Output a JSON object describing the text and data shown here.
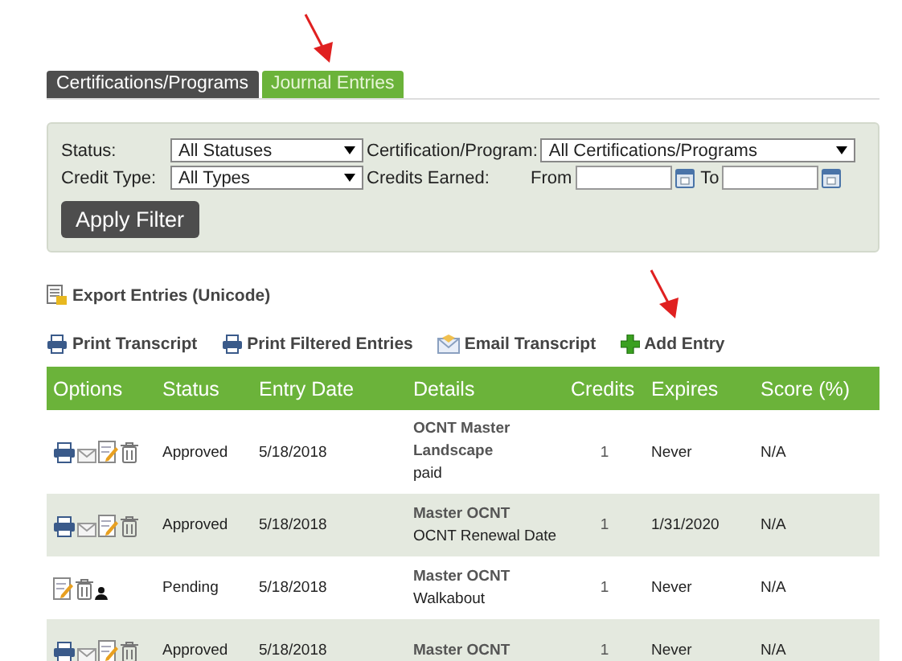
{
  "tabs": [
    {
      "label": "Certifications/Programs",
      "selected": false
    },
    {
      "label": "Journal Entries",
      "selected": true
    }
  ],
  "filter": {
    "status": {
      "label": "Status:",
      "value": "All Statuses"
    },
    "certification": {
      "label": "Certification/Program:",
      "value": "All Certifications/Programs"
    },
    "credit_type": {
      "label": "Credit Type:",
      "value": "All Types"
    },
    "credits_earned": {
      "label": "Credits Earned:",
      "from_label": "From",
      "to_label": "To"
    },
    "apply_button": "Apply Filter"
  },
  "export_link": "Export Entries (Unicode)",
  "actions": [
    {
      "kind": "print",
      "label": "Print Transcript"
    },
    {
      "kind": "print",
      "label": "Print Filtered Entries"
    },
    {
      "kind": "email",
      "label": "Email Transcript"
    },
    {
      "kind": "add",
      "label": "Add Entry"
    }
  ],
  "table": {
    "columns": [
      "Options",
      "Status",
      "Entry Date",
      "Details",
      "Credits",
      "Expires",
      "Score (%)"
    ],
    "rows": [
      {
        "options": [
          {
            "kind": "print"
          },
          {
            "kind": "email"
          },
          {
            "kind": "edit"
          },
          {
            "kind": "delete"
          }
        ],
        "status": "Approved",
        "entry_date": "5/18/2018",
        "program": "OCNT Master Landscape",
        "title": "paid",
        "credits": "1",
        "expires": "Never",
        "score": "N/A"
      },
      {
        "options": [
          {
            "kind": "print"
          },
          {
            "kind": "email"
          },
          {
            "kind": "edit"
          },
          {
            "kind": "delete"
          }
        ],
        "status": "Approved",
        "entry_date": "5/18/2018",
        "program": "Master OCNT",
        "title": "OCNT Renewal Date",
        "credits": "1",
        "expires": "1/31/2020",
        "score": "N/A"
      },
      {
        "options": [
          {
            "kind": "edit"
          },
          {
            "kind": "delete"
          },
          {
            "kind": "user"
          }
        ],
        "status": "Pending",
        "entry_date": "5/18/2018",
        "program": "Master OCNT",
        "title": "Walkabout",
        "credits": "1",
        "expires": "Never",
        "score": "N/A"
      },
      {
        "options": [
          {
            "kind": "print"
          },
          {
            "kind": "email"
          },
          {
            "kind": "edit"
          },
          {
            "kind": "delete"
          }
        ],
        "status": "Approved",
        "entry_date": "5/18/2018",
        "program": "Master OCNT",
        "credits": "1",
        "expires": "Never",
        "score": "N/A"
      }
    ]
  }
}
